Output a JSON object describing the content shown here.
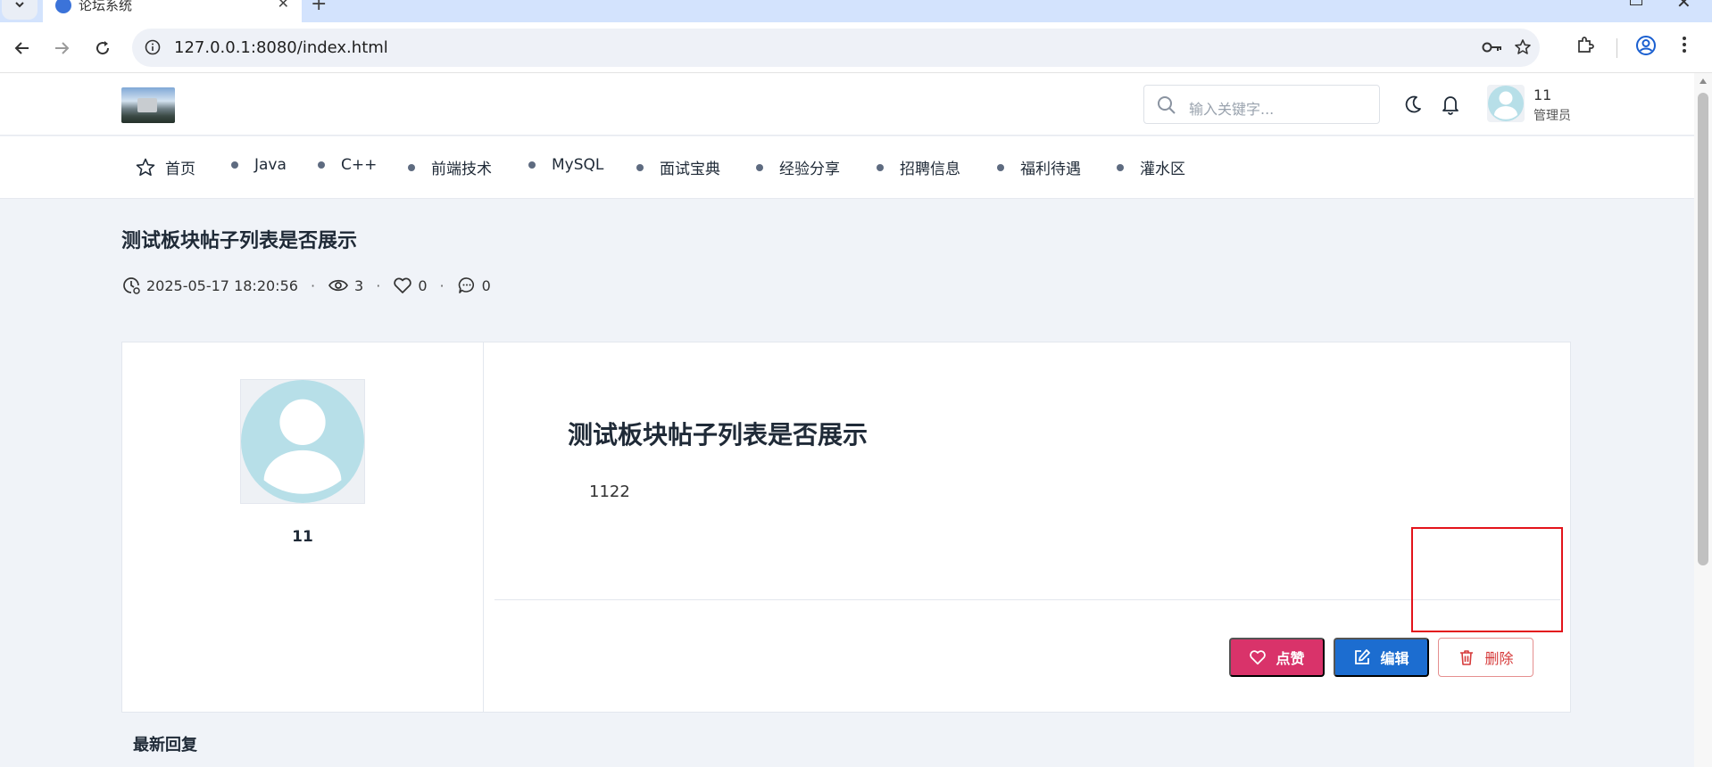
{
  "browser": {
    "tab_title": "论坛系统",
    "tab_close": "✕",
    "new_tab": "+",
    "window_close": "✕",
    "url": "127.0.0.1:8080/index.html"
  },
  "header": {
    "search_placeholder": "输入关键字...",
    "user": {
      "name": "11",
      "role": "管理员"
    }
  },
  "nav": {
    "items": [
      {
        "label": "首页",
        "icon": "star-icon"
      },
      {
        "label": "Java"
      },
      {
        "label": "C++"
      },
      {
        "label": "前端技术"
      },
      {
        "label": "MySQL"
      },
      {
        "label": "面试宝典"
      },
      {
        "label": "经验分享"
      },
      {
        "label": "招聘信息"
      },
      {
        "label": "福利待遇"
      },
      {
        "label": "灌水区"
      }
    ]
  },
  "post": {
    "title": "测试板块帖子列表是否展示",
    "timestamp": "2025-05-17 18:20:56",
    "views": "3",
    "likes": "0",
    "replies": "0",
    "separator": "·",
    "author": "11",
    "content_title": "测试板块帖子列表是否展示",
    "content_body": "1122"
  },
  "actions": {
    "like_label": "点赞",
    "edit_label": "编辑",
    "delete_label": "删除"
  },
  "sections": {
    "latest_replies": "最新回复"
  },
  "colors": {
    "like_button": "#d9336a",
    "edit_button": "#1c6dd0",
    "delete_button_text": "#d63a3a",
    "highlight_box": "#e3131b",
    "page_background": "#f0f3f8",
    "avatar_color": "#b7dfe8"
  }
}
